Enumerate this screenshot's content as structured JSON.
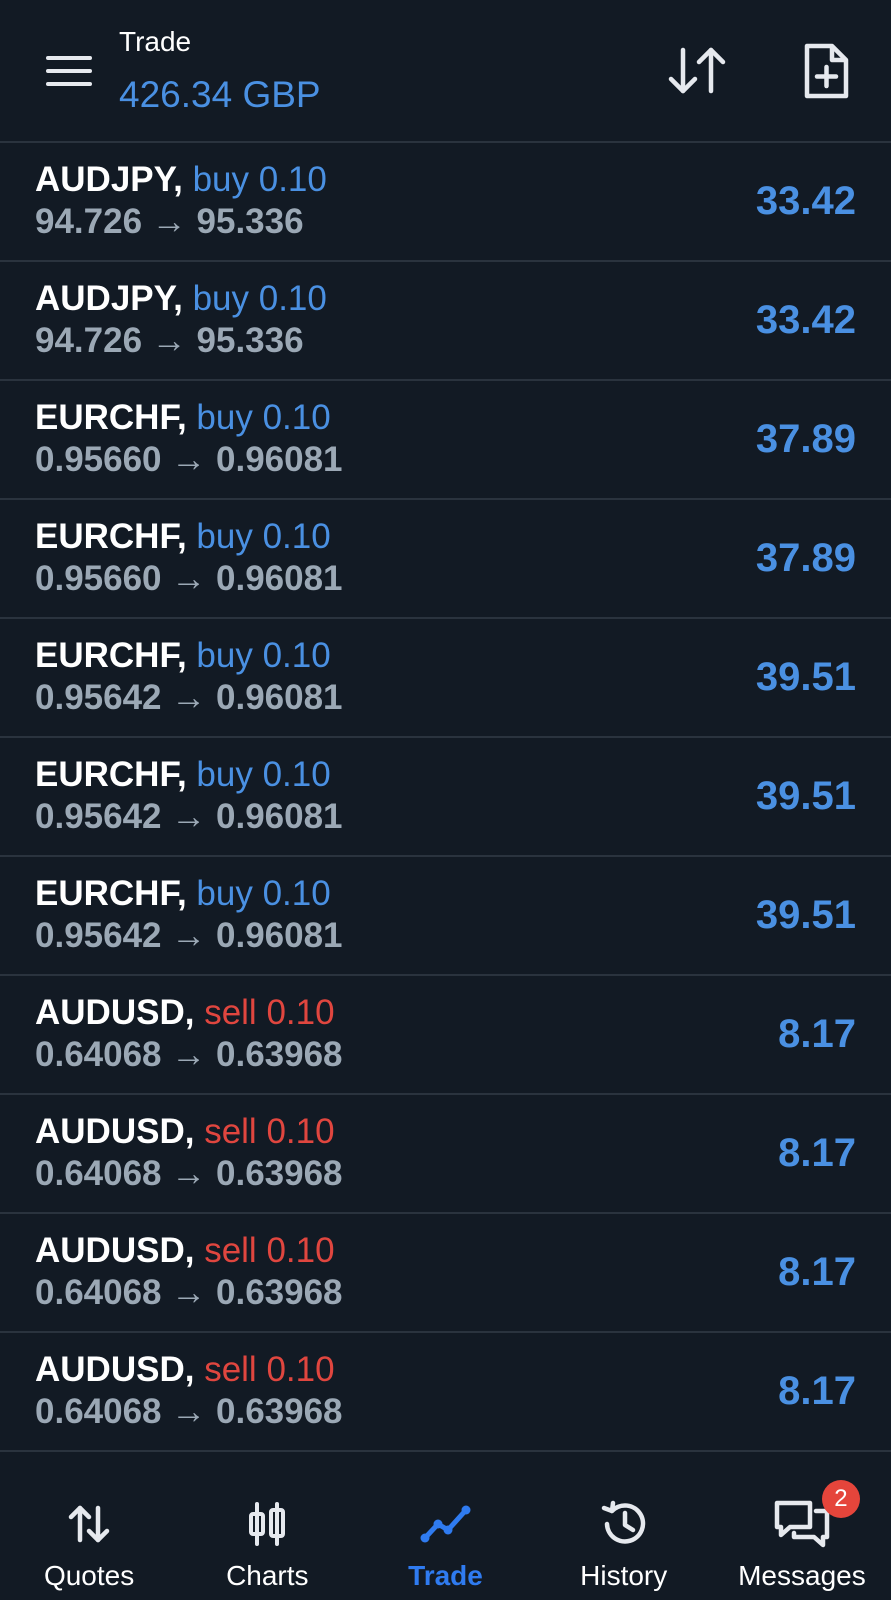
{
  "header": {
    "title": "Trade",
    "balance": "426.34 GBP",
    "menu_icon": "hamburger-menu-icon",
    "sort_icon": "sort-arrows-icon",
    "new_order_icon": "new-document-icon"
  },
  "colors": {
    "background": "#121a24",
    "accent_blue": "#4a90e2",
    "active_blue": "#2f7bf0",
    "sell_red": "#e0463f",
    "price_gray": "#9ba8b5",
    "divider": "#2a333e",
    "badge_red": "#e5453b"
  },
  "positions": [
    {
      "symbol": "AUDJPY,",
      "side": "buy",
      "volume": "0.10",
      "open_price": "94.726",
      "arrow": "→",
      "current_price": "95.336",
      "profit": "33.42"
    },
    {
      "symbol": "AUDJPY,",
      "side": "buy",
      "volume": "0.10",
      "open_price": "94.726",
      "arrow": "→",
      "current_price": "95.336",
      "profit": "33.42"
    },
    {
      "symbol": "EURCHF,",
      "side": "buy",
      "volume": "0.10",
      "open_price": "0.95660",
      "arrow": "→",
      "current_price": "0.96081",
      "profit": "37.89"
    },
    {
      "symbol": "EURCHF,",
      "side": "buy",
      "volume": "0.10",
      "open_price": "0.95660",
      "arrow": "→",
      "current_price": "0.96081",
      "profit": "37.89"
    },
    {
      "symbol": "EURCHF,",
      "side": "buy",
      "volume": "0.10",
      "open_price": "0.95642",
      "arrow": "→",
      "current_price": "0.96081",
      "profit": "39.51"
    },
    {
      "symbol": "EURCHF,",
      "side": "buy",
      "volume": "0.10",
      "open_price": "0.95642",
      "arrow": "→",
      "current_price": "0.96081",
      "profit": "39.51"
    },
    {
      "symbol": "EURCHF,",
      "side": "buy",
      "volume": "0.10",
      "open_price": "0.95642",
      "arrow": "→",
      "current_price": "0.96081",
      "profit": "39.51"
    },
    {
      "symbol": "AUDUSD,",
      "side": "sell",
      "volume": "0.10",
      "open_price": "0.64068",
      "arrow": "→",
      "current_price": "0.63968",
      "profit": "8.17"
    },
    {
      "symbol": "AUDUSD,",
      "side": "sell",
      "volume": "0.10",
      "open_price": "0.64068",
      "arrow": "→",
      "current_price": "0.63968",
      "profit": "8.17"
    },
    {
      "symbol": "AUDUSD,",
      "side": "sell",
      "volume": "0.10",
      "open_price": "0.64068",
      "arrow": "→",
      "current_price": "0.63968",
      "profit": "8.17"
    },
    {
      "symbol": "AUDUSD,",
      "side": "sell",
      "volume": "0.10",
      "open_price": "0.64068",
      "arrow": "→",
      "current_price": "0.63968",
      "profit": "8.17"
    }
  ],
  "nav": {
    "quotes": {
      "label": "Quotes",
      "icon": "quotes-arrows-icon"
    },
    "charts": {
      "label": "Charts",
      "icon": "candlestick-chart-icon"
    },
    "trade": {
      "label": "Trade",
      "icon": "trade-line-icon",
      "active": true
    },
    "history": {
      "label": "History",
      "icon": "history-clock-icon"
    },
    "messages": {
      "label": "Messages",
      "icon": "chat-bubbles-icon",
      "badge": "2"
    }
  }
}
